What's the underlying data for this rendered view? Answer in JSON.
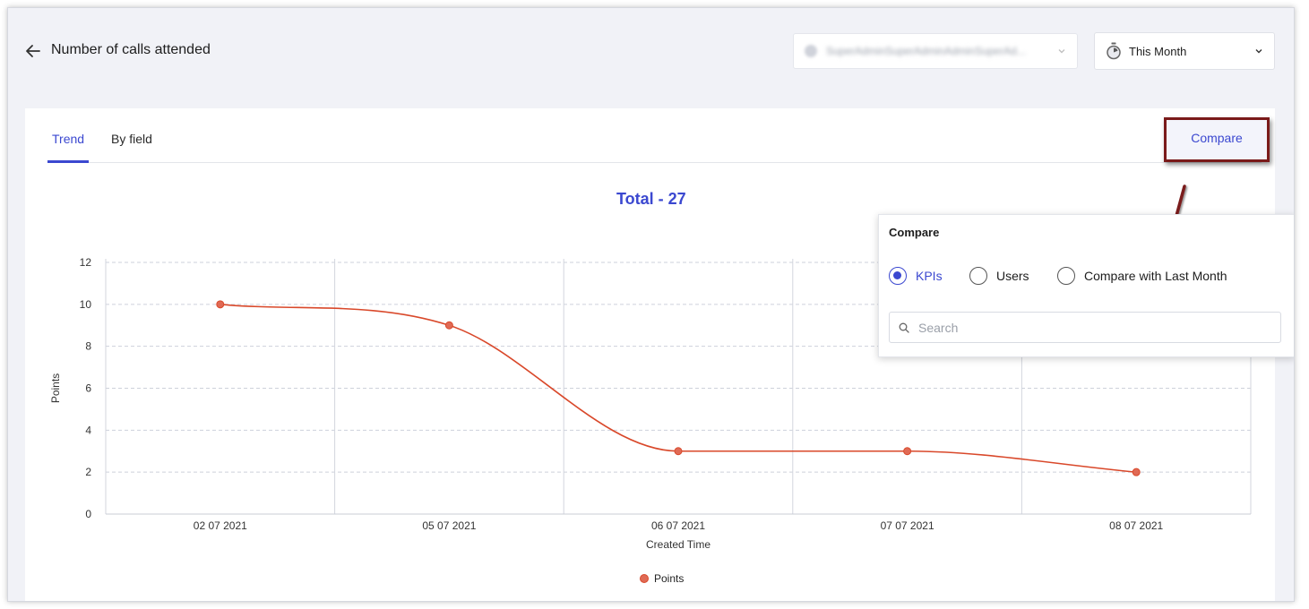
{
  "header": {
    "title": "Number of calls attended",
    "user_select_value": "SuperAdminSuperAdminAdminSuperAd...",
    "period_select_value": "This Month"
  },
  "tabs": [
    {
      "label": "Trend",
      "active": true
    },
    {
      "label": "By field",
      "active": false
    }
  ],
  "compare_button_label": "Compare",
  "total_label": "Total - 27",
  "popup": {
    "title": "Compare",
    "options": [
      {
        "label": "KPIs",
        "checked": true
      },
      {
        "label": "Users",
        "checked": false
      },
      {
        "label": "Compare with Last Month",
        "checked": false
      }
    ],
    "search_placeholder": "Search"
  },
  "colors": {
    "accent": "#3b48d0",
    "series": "#d9482a",
    "annotation": "#7a1a1a"
  },
  "icons": {
    "back": "arrow-left-icon",
    "period": "stopwatch-icon",
    "dropdown": "chevron-down-icon",
    "search": "search-icon"
  },
  "chart_data": {
    "type": "line",
    "categories": [
      "02 07 2021",
      "05 07 2021",
      "06 07 2021",
      "07 07 2021",
      "08 07 2021"
    ],
    "series": [
      {
        "name": "Points",
        "values": [
          10,
          9,
          3,
          3,
          2
        ]
      }
    ],
    "xlabel": "Created Time",
    "ylabel": "Points",
    "ylim": [
      0,
      12
    ],
    "yticks": [
      0,
      2,
      4,
      6,
      8,
      10,
      12
    ],
    "grid": true,
    "legend": "bottom-center"
  }
}
